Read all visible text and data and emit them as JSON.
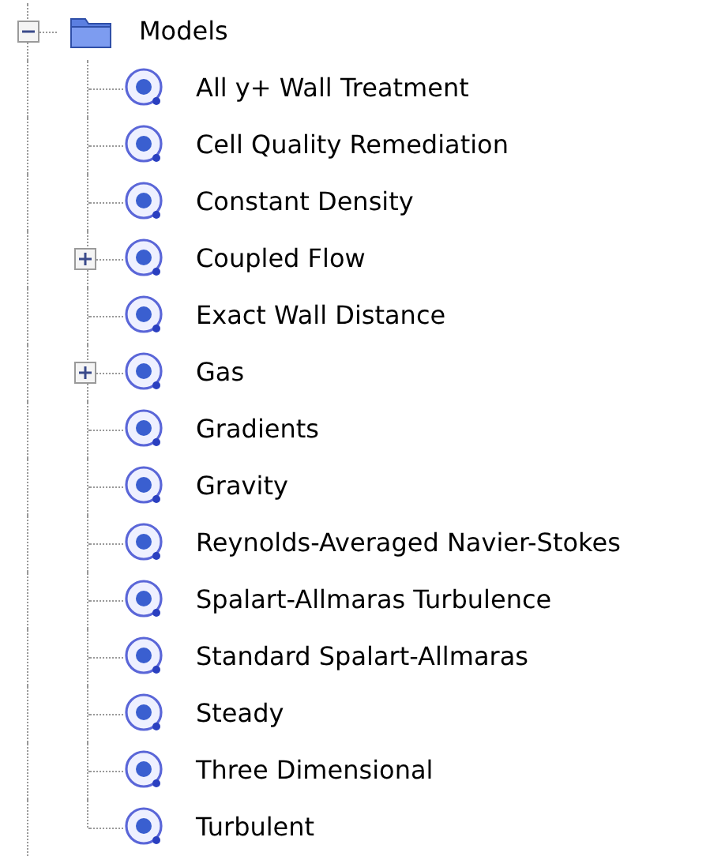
{
  "tree": {
    "label": "Models",
    "expanded": true,
    "children": [
      {
        "label": "All y+ Wall Treatment"
      },
      {
        "label": "Cell Quality Remediation"
      },
      {
        "label": "Constant Density"
      },
      {
        "label": "Coupled Flow",
        "expanded": false
      },
      {
        "label": "Exact Wall Distance"
      },
      {
        "label": "Gas",
        "expanded": false
      },
      {
        "label": "Gradients"
      },
      {
        "label": "Gravity"
      },
      {
        "label": "Reynolds-Averaged Navier-Stokes"
      },
      {
        "label": "Spalart-Allmaras Turbulence"
      },
      {
        "label": "Standard Spalart-Allmaras"
      },
      {
        "label": "Steady"
      },
      {
        "label": "Three Dimensional"
      },
      {
        "label": "Turbulent"
      }
    ]
  }
}
